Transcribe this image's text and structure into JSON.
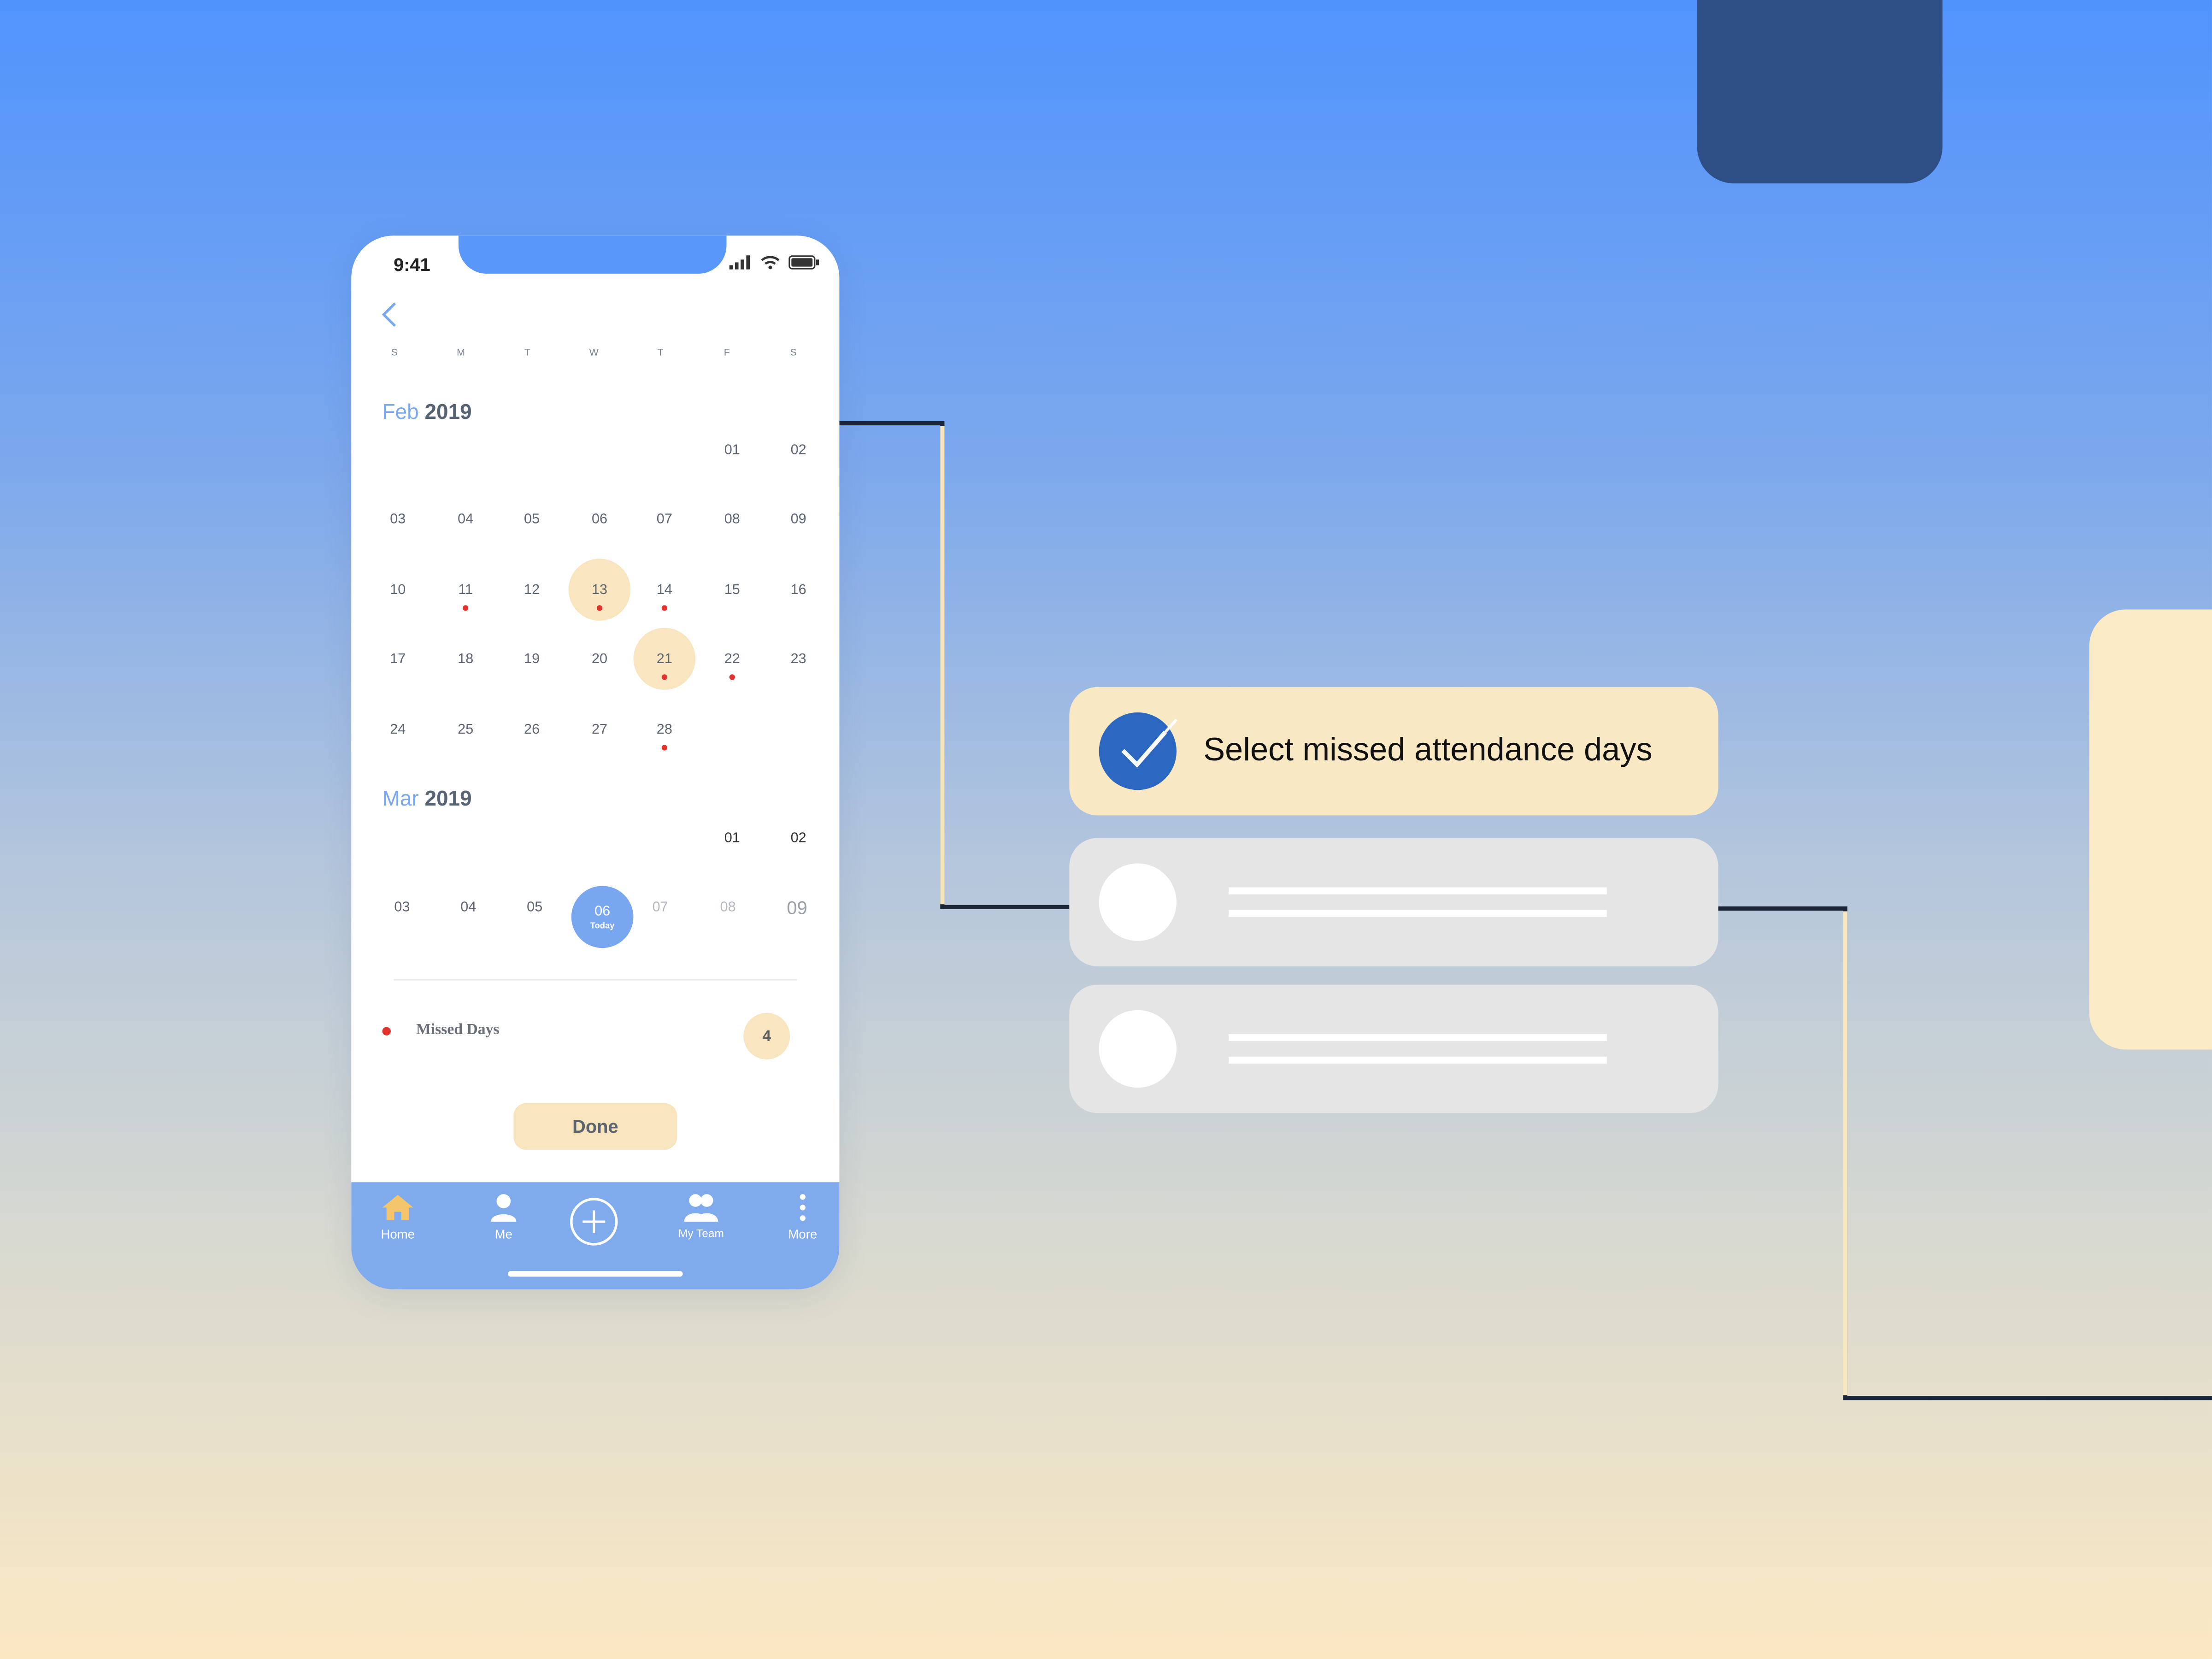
{
  "colors": {
    "accent_blue": "#78a7ef",
    "selected_yellow": "#f9e6c1",
    "missed_dot": "#e3322e",
    "check_blue": "#2b67c0",
    "card_gray": "#e5e5e5"
  },
  "status_bar": {
    "time": "9:41",
    "icons": [
      "signal-icon",
      "wifi-icon",
      "battery-icon"
    ]
  },
  "weekdays": [
    "S",
    "M",
    "T",
    "W",
    "T",
    "F",
    "S"
  ],
  "feb": {
    "month": "Feb",
    "year": "2019",
    "days": [
      {
        "label": "01",
        "missed": false,
        "selected": false
      },
      {
        "label": "02",
        "missed": false,
        "selected": false
      },
      {
        "label": "03",
        "missed": false,
        "selected": false
      },
      {
        "label": "04",
        "missed": false,
        "selected": false
      },
      {
        "label": "05",
        "missed": false,
        "selected": false
      },
      {
        "label": "06",
        "missed": false,
        "selected": false
      },
      {
        "label": "07",
        "missed": false,
        "selected": false
      },
      {
        "label": "08",
        "missed": false,
        "selected": false
      },
      {
        "label": "09",
        "missed": false,
        "selected": false
      },
      {
        "label": "10",
        "missed": false,
        "selected": false
      },
      {
        "label": "11",
        "missed": true,
        "selected": false
      },
      {
        "label": "12",
        "missed": false,
        "selected": false
      },
      {
        "label": "13",
        "missed": true,
        "selected": true
      },
      {
        "label": "14",
        "missed": true,
        "selected": false
      },
      {
        "label": "15",
        "missed": false,
        "selected": false
      },
      {
        "label": "16",
        "missed": false,
        "selected": false
      },
      {
        "label": "17",
        "missed": false,
        "selected": false
      },
      {
        "label": "18",
        "missed": false,
        "selected": false
      },
      {
        "label": "19",
        "missed": false,
        "selected": false
      },
      {
        "label": "20",
        "missed": false,
        "selected": false
      },
      {
        "label": "21",
        "missed": true,
        "selected": true
      },
      {
        "label": "22",
        "missed": true,
        "selected": false
      },
      {
        "label": "23",
        "missed": false,
        "selected": false
      },
      {
        "label": "24",
        "missed": false,
        "selected": false
      },
      {
        "label": "25",
        "missed": false,
        "selected": false
      },
      {
        "label": "26",
        "missed": false,
        "selected": false
      },
      {
        "label": "27",
        "missed": false,
        "selected": false
      },
      {
        "label": "28",
        "missed": true,
        "selected": false
      }
    ]
  },
  "mar": {
    "month": "Mar",
    "year": "2019",
    "days": [
      {
        "label": "01",
        "state": "dark"
      },
      {
        "label": "02",
        "state": "dark"
      },
      {
        "label": "03",
        "state": "normal"
      },
      {
        "label": "04",
        "state": "normal"
      },
      {
        "label": "05",
        "state": "normal"
      },
      {
        "label": "06",
        "state": "today",
        "sub": "Today"
      },
      {
        "label": "07",
        "state": "faded"
      },
      {
        "label": "08",
        "state": "faded"
      },
      {
        "label": "09",
        "state": "big"
      }
    ]
  },
  "legend": {
    "label": "Missed Days",
    "count": "4"
  },
  "done_label": "Done",
  "tabs": [
    {
      "label": "Home",
      "icon": "home-icon"
    },
    {
      "label": "Me",
      "icon": "person-icon"
    },
    {
      "label": "",
      "icon": "add-circle-icon"
    },
    {
      "label": "My Team",
      "icon": "team-icon"
    },
    {
      "label": "More",
      "icon": "more-dots-icon"
    }
  ],
  "options": {
    "active_title": "Select missed attendance days",
    "active_icon": "checkmark-icon"
  }
}
